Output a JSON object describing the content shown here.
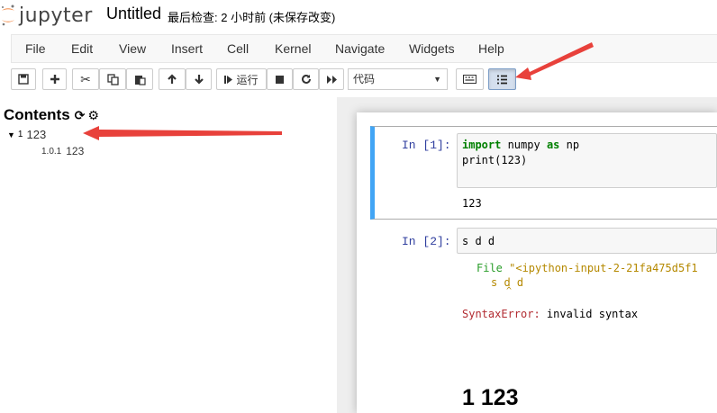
{
  "header": {
    "logo_text": "jupyter",
    "notebook_name": "Untitled",
    "checkpoint": "最后检查: 2 小时前  (未保存改变)"
  },
  "menu": [
    "File",
    "Edit",
    "View",
    "Insert",
    "Cell",
    "Kernel",
    "Navigate",
    "Widgets",
    "Help"
  ],
  "toolbar": {
    "run_label": "运行",
    "cell_type": "代码"
  },
  "toc": {
    "title": "Contents",
    "items": [
      {
        "num": "1",
        "label": "123"
      },
      {
        "num": "1.0.1",
        "label": "123"
      }
    ]
  },
  "cells": [
    {
      "prompt": "In  [1]:",
      "code_lines": [
        {
          "kw1": "import",
          "t1": " numpy ",
          "kw2": "as",
          "t2": " np"
        },
        {
          "t": "print(123)"
        }
      ],
      "output": "123"
    },
    {
      "prompt": "In  [2]:",
      "code": "s d d",
      "error": {
        "file_label": "File",
        "file_path": " \"<ipython-input-2-21fa475d5f1",
        "src": "s d d",
        "caret": "^",
        "type": "SyntaxError:",
        "msg": " invalid syntax"
      }
    }
  ],
  "markdown_heading": "1  123",
  "colors": {
    "accent_arrow": "#e8413b",
    "prompt_in": "#303f9f",
    "selected_border": "#42a5f5"
  }
}
